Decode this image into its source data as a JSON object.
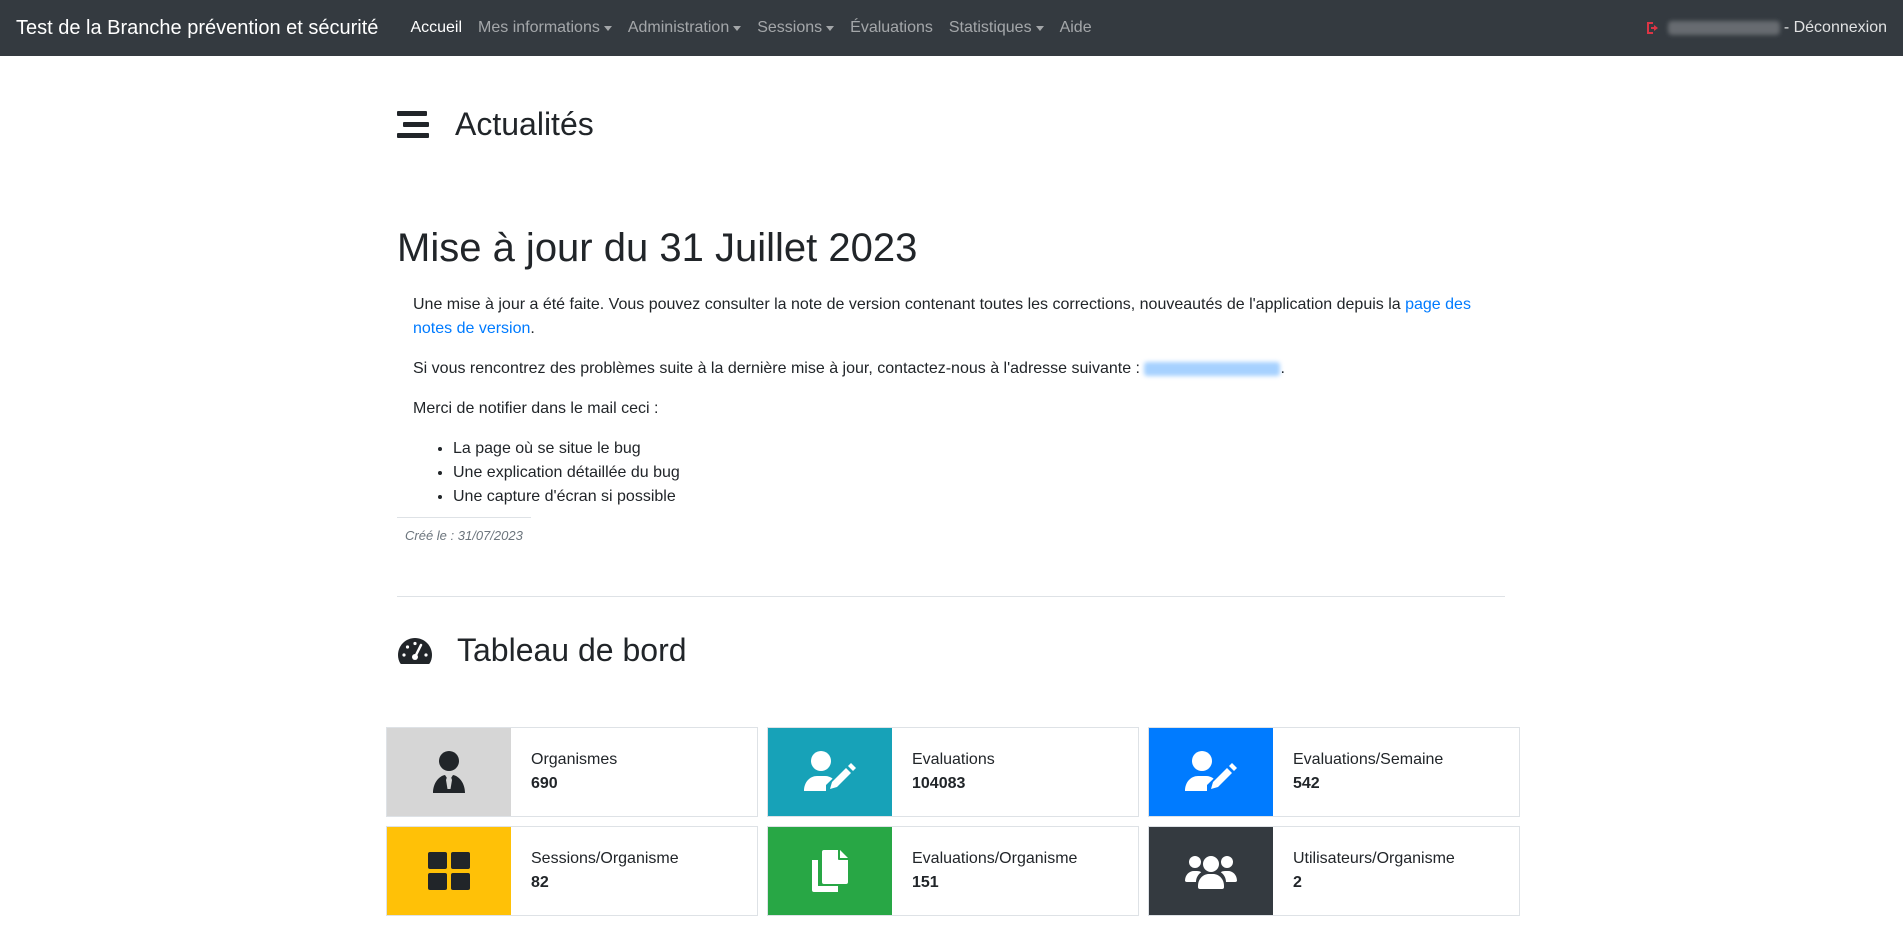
{
  "navbar": {
    "brand": "Test de la Branche prévention et sécurité",
    "items": [
      {
        "label": "Accueil",
        "active": true,
        "dropdown": false
      },
      {
        "label": "Mes informations",
        "active": false,
        "dropdown": true
      },
      {
        "label": "Administration",
        "active": false,
        "dropdown": true
      },
      {
        "label": "Sessions",
        "active": false,
        "dropdown": true
      },
      {
        "label": "Évaluations",
        "active": false,
        "dropdown": false
      },
      {
        "label": "Statistiques",
        "active": false,
        "dropdown": true
      },
      {
        "label": "Aide",
        "active": false,
        "dropdown": false
      }
    ],
    "logout_label": "- Déconnexion"
  },
  "news": {
    "heading": "Actualités",
    "title": "Mise à jour du 31 Juillet 2023",
    "p1_text": "Une mise à jour a été faite. Vous pouvez consulter la note de version contenant toutes les corrections, nouveautés de l'application depuis la ",
    "p1_link": "page des notes de version",
    "p1_end": ".",
    "p2_text": "Si vous rencontrez des problèmes suite à la dernière mise à jour, contactez-nous à l'adresse suivante : ",
    "p2_end": ".",
    "p3_text": "Merci de notifier dans le mail ceci :",
    "list": [
      "La page où se situe le bug",
      "Une explication détaillée du bug",
      "Une capture d'écran si possible"
    ],
    "created": "Créé le : 31/07/2023"
  },
  "dashboard": {
    "heading": "Tableau de bord",
    "cards": [
      {
        "label": "Organismes",
        "value": "690",
        "icon": "user-tie-icon",
        "color": "#d6d6d6",
        "icon_color": "#212529"
      },
      {
        "label": "Evaluations",
        "value": "104083",
        "icon": "user-edit-icon",
        "color": "#17a2b8",
        "icon_color": "#ffffff"
      },
      {
        "label": "Evaluations/Semaine",
        "value": "542",
        "icon": "user-edit-icon",
        "color": "#007bff",
        "icon_color": "#ffffff"
      },
      {
        "label": "Sessions/Organisme",
        "value": "82",
        "icon": "grid-icon",
        "color": "#ffc107",
        "icon_color": "#212529"
      },
      {
        "label": "Evaluations/Organisme",
        "value": "151",
        "icon": "copy-icon",
        "color": "#28a745",
        "icon_color": "#ffffff"
      },
      {
        "label": "Utilisateurs/Organisme",
        "value": "2",
        "icon": "users-icon",
        "color": "#343a40",
        "icon_color": "#ffffff"
      }
    ]
  }
}
